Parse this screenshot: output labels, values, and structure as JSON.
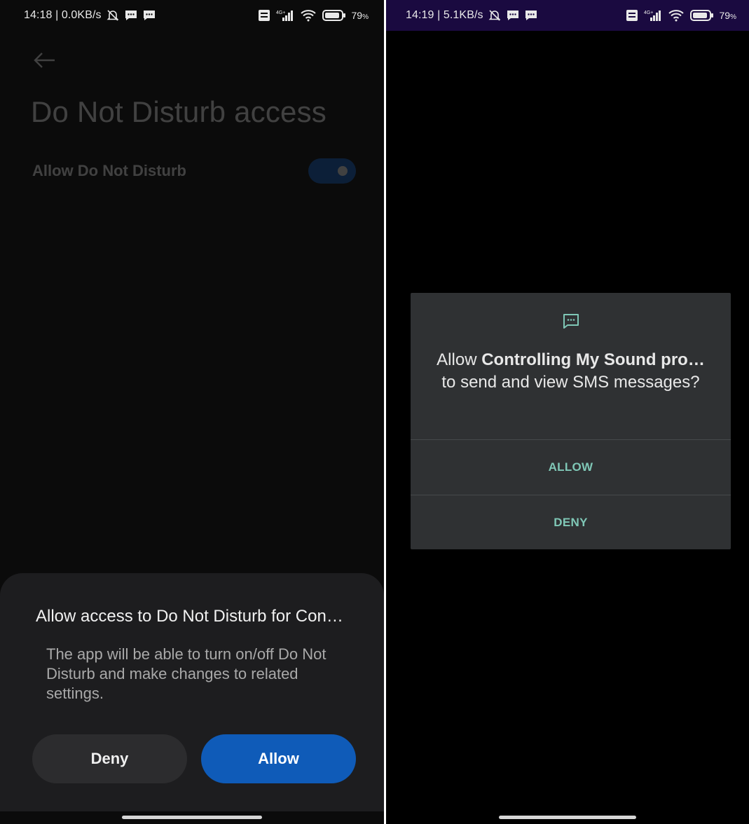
{
  "left_screen": {
    "status_bar": {
      "time_speed": "14:18 | 0.0KB/s",
      "network": "4G+",
      "battery": "79",
      "battery_unit": "%"
    },
    "page_title": "Do Not Disturb access",
    "setting": {
      "label": "Allow Do Not Disturb",
      "toggle_on": true
    },
    "sheet": {
      "title": "Allow access to Do Not Disturb for Con…",
      "body": "The app will be able to turn on/off Do Not Disturb and make changes to related settings.",
      "deny_label": "Deny",
      "allow_label": "Allow"
    }
  },
  "right_screen": {
    "status_bar": {
      "time_speed": "14:19 | 5.1KB/s",
      "network": "4G+",
      "battery": "79",
      "battery_unit": "%"
    },
    "dialog": {
      "icon": "sms-message-icon",
      "message_prefix": "Allow ",
      "app_name": "Controlling My Sound pro…",
      "message_suffix": " to send and view SMS messages?",
      "allow_label": "ALLOW",
      "deny_label": "DENY"
    }
  },
  "colors": {
    "allow_button": "#0f5bb8",
    "dialog_accent": "#7fc7b6",
    "toggle": "#1168d8"
  }
}
